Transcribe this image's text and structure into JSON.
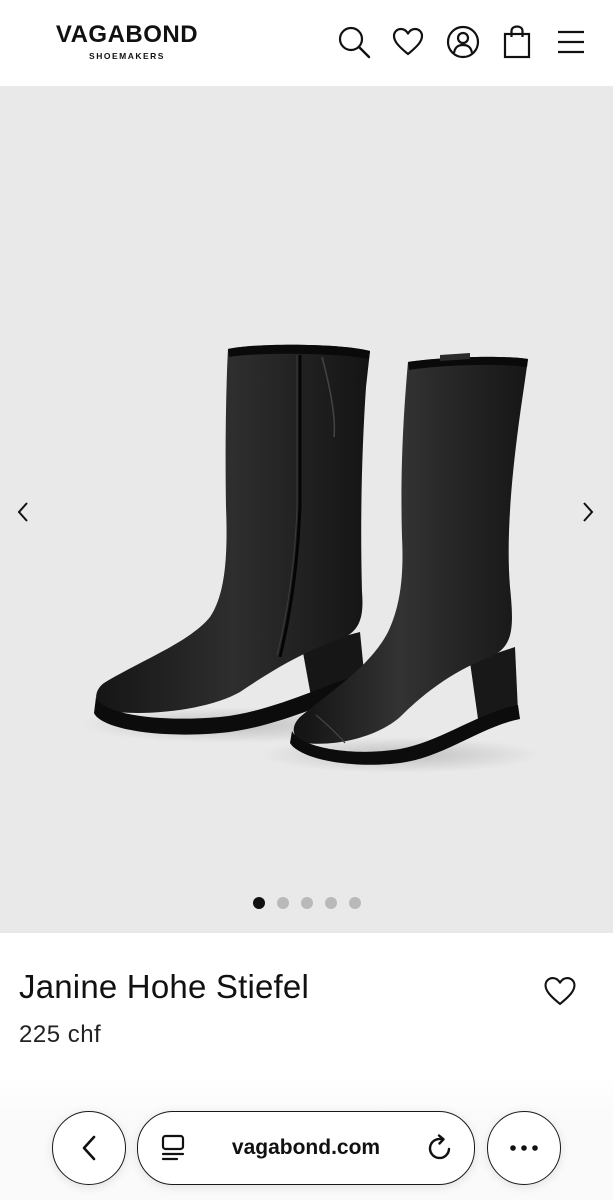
{
  "header": {
    "brand": "VAGABOND",
    "brand_sub": "SHOEMAKERS",
    "icons": [
      "search-icon",
      "heart-icon",
      "account-icon",
      "bag-icon",
      "menu-icon"
    ]
  },
  "gallery": {
    "image_subject": "pair-of-black-leather-mid-calf-boots",
    "prev_icon": "chevron-left-icon",
    "next_icon": "chevron-right-icon",
    "slides_count": 5,
    "active_slide": 1
  },
  "product": {
    "title": "Janine Hohe Stiefel",
    "price": "225 chf",
    "wishlist_icon": "heart-outline-icon"
  },
  "browser": {
    "url": "vagabond.com",
    "back_icon": "chevron-left-icon",
    "tabs_icon": "reader-icon",
    "reload_icon": "reload-icon",
    "more_icon": "ellipsis-icon"
  },
  "colors": {
    "background": "#ffffff",
    "gallery_bg": "#e9e9e9",
    "text": "#111111",
    "dot_active": "#111111",
    "dot_inactive": "#b9b9b9"
  }
}
